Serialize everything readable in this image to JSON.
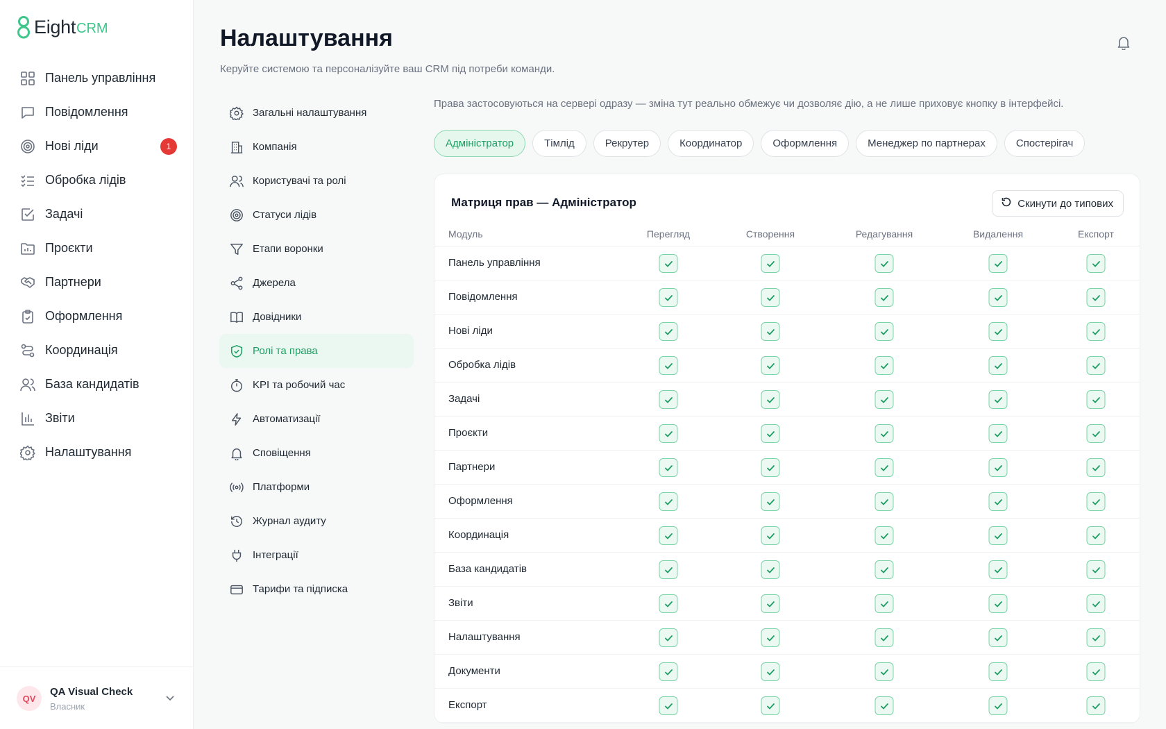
{
  "app": {
    "brand": "Eight",
    "brand_sub": "CRM",
    "accent": "#3ec68b"
  },
  "sidebar": {
    "items": [
      {
        "label": "Панель управління",
        "icon": "dashboard-grid-icon"
      },
      {
        "label": "Повідомлення",
        "icon": "message-icon"
      },
      {
        "label": "Нові ліди",
        "icon": "target-icon",
        "badge": "1"
      },
      {
        "label": "Обробка лідів",
        "icon": "checklist-icon"
      },
      {
        "label": "Задачі",
        "icon": "task-check-icon"
      },
      {
        "label": "Проєкти",
        "icon": "folder-chart-icon"
      },
      {
        "label": "Партнери",
        "icon": "handshake-icon"
      },
      {
        "label": "Оформлення",
        "icon": "clipboard-icon"
      },
      {
        "label": "Координація",
        "icon": "route-icon"
      },
      {
        "label": "База кандидатів",
        "icon": "users-icon"
      },
      {
        "label": "Звіти",
        "icon": "bar-chart-icon"
      },
      {
        "label": "Налаштування",
        "icon": "gear-icon"
      }
    ],
    "user": {
      "initials": "QV",
      "name": "QA Visual Check",
      "role": "Власник"
    }
  },
  "header": {
    "title": "Налаштування",
    "subtitle": "Керуйте системою та персоналізуйте ваш CRM під потреби команди."
  },
  "settings_nav": {
    "items": [
      {
        "label": "Загальні налаштування",
        "icon": "gear-icon"
      },
      {
        "label": "Компанія",
        "icon": "building-icon"
      },
      {
        "label": "Користувачі та ролі",
        "icon": "users-icon"
      },
      {
        "label": "Статуси лідів",
        "icon": "target-icon"
      },
      {
        "label": "Етапи воронки",
        "icon": "funnel-icon"
      },
      {
        "label": "Джерела",
        "icon": "share-icon"
      },
      {
        "label": "Довідники",
        "icon": "book-icon"
      },
      {
        "label": "Ролі та права",
        "icon": "shield-check-icon",
        "active": true
      },
      {
        "label": "KPI та робочий час",
        "icon": "stopwatch-icon"
      },
      {
        "label": "Автоматизації",
        "icon": "lightning-icon"
      },
      {
        "label": "Сповіщення",
        "icon": "bell-icon"
      },
      {
        "label": "Платформи",
        "icon": "broadcast-icon"
      },
      {
        "label": "Журнал аудиту",
        "icon": "history-icon"
      },
      {
        "label": "Інтеграції",
        "icon": "plug-icon"
      },
      {
        "label": "Тарифи та підписка",
        "icon": "credit-card-icon"
      }
    ]
  },
  "roles_section": {
    "notice": "Права застосовуються на сервері одразу — зміна тут реально обмежує чи дозволяє дію, а не лише приховує кнопку в інтерфейсі.",
    "roles": [
      "Адміністратор",
      "Тімлід",
      "Рекрутер",
      "Координатор",
      "Оформлення",
      "Менеджер по партнерах",
      "Спостерігач"
    ],
    "active_role": "Адміністратор"
  },
  "matrix": {
    "title": "Матриця прав — Адміністратор",
    "reset_label": "Скинути до типових",
    "columns": [
      "Модуль",
      "Перегляд",
      "Створення",
      "Редагування",
      "Видалення",
      "Експорт"
    ],
    "rows": [
      {
        "module": "Панель управління",
        "perms": [
          true,
          true,
          true,
          true,
          true
        ]
      },
      {
        "module": "Повідомлення",
        "perms": [
          true,
          true,
          true,
          true,
          true
        ]
      },
      {
        "module": "Нові ліди",
        "perms": [
          true,
          true,
          true,
          true,
          true
        ]
      },
      {
        "module": "Обробка лідів",
        "perms": [
          true,
          true,
          true,
          true,
          true
        ]
      },
      {
        "module": "Задачі",
        "perms": [
          true,
          true,
          true,
          true,
          true
        ]
      },
      {
        "module": "Проєкти",
        "perms": [
          true,
          true,
          true,
          true,
          true
        ]
      },
      {
        "module": "Партнери",
        "perms": [
          true,
          true,
          true,
          true,
          true
        ]
      },
      {
        "module": "Оформлення",
        "perms": [
          true,
          true,
          true,
          true,
          true
        ]
      },
      {
        "module": "Координація",
        "perms": [
          true,
          true,
          true,
          true,
          true
        ]
      },
      {
        "module": "База кандидатів",
        "perms": [
          true,
          true,
          true,
          true,
          true
        ]
      },
      {
        "module": "Звіти",
        "perms": [
          true,
          true,
          true,
          true,
          true
        ]
      },
      {
        "module": "Налаштування",
        "perms": [
          true,
          true,
          true,
          true,
          true
        ]
      },
      {
        "module": "Документи",
        "perms": [
          true,
          true,
          true,
          true,
          true
        ]
      },
      {
        "module": "Експорт",
        "perms": [
          true,
          true,
          true,
          true,
          true
        ]
      }
    ]
  }
}
